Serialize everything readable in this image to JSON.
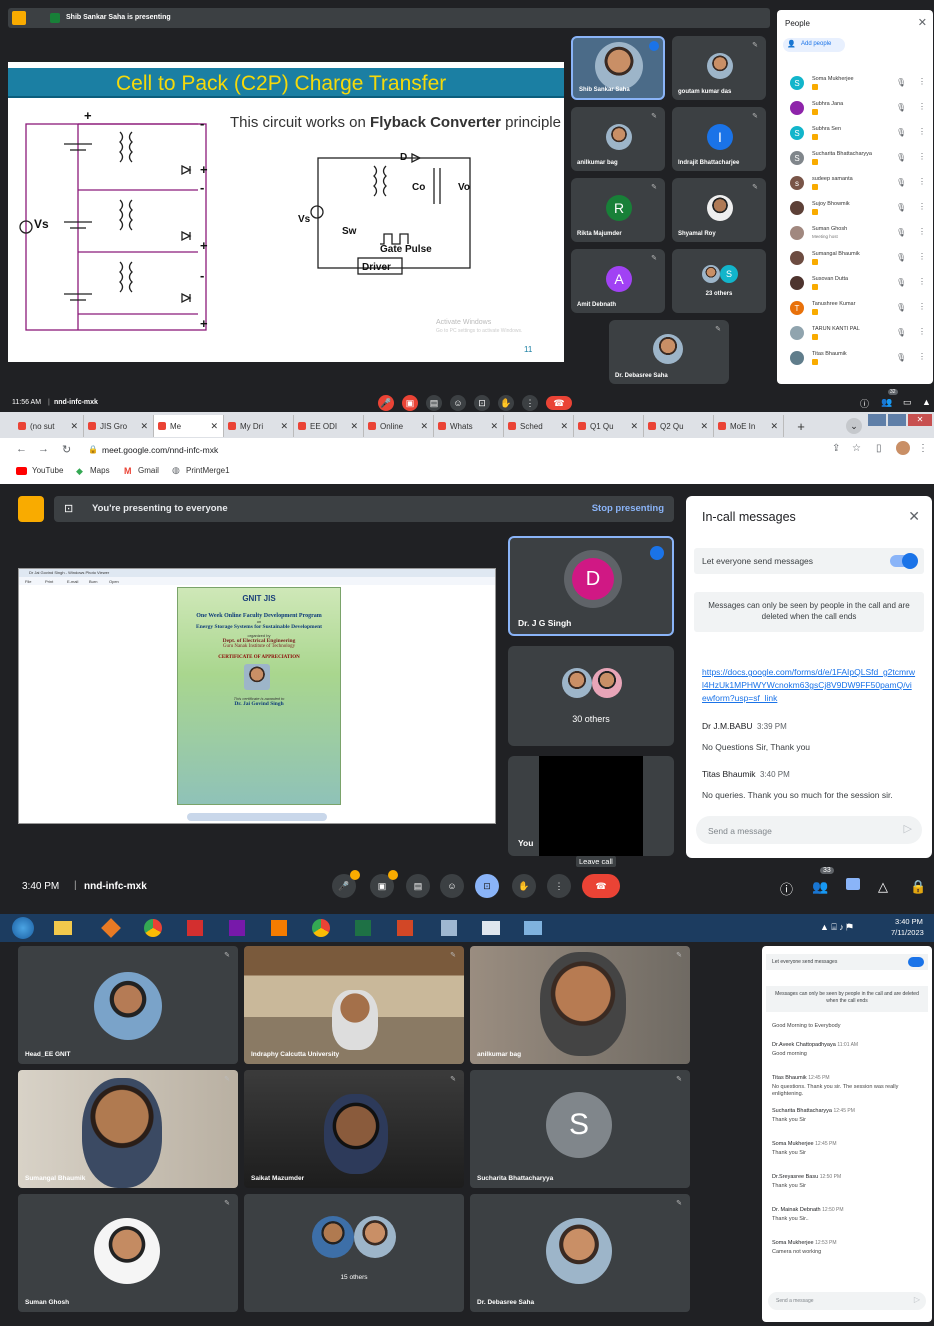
{
  "panel1": {
    "presenting_banner": "Shib Sankar Saha is presenting",
    "slide": {
      "title": "Cell to Pack (C2P) Charge Transfer",
      "subtitle_pre": "This circuit works on ",
      "subtitle_bold": "Flyback Converter",
      "subtitle_post": " principle",
      "label_vs_left": "Vs",
      "label_vs": "Vs",
      "label_d": "D",
      "label_co": "Co",
      "label_vo": "Vo",
      "label_sw": "Sw",
      "label_gate": "Gate Pulse",
      "label_driver": "Driver",
      "plus": "+",
      "minus": "-",
      "watermark1": "Activate Windows",
      "watermark2": "Go to PC settings to activate Windows.",
      "page": "11"
    },
    "tiles": [
      {
        "name": "Shib Sankar Saha"
      },
      {
        "name": "goutam kumar das"
      },
      {
        "name": "anilkumar bag"
      },
      {
        "name": "Indrajit Bhattacharjee",
        "letter": "I",
        "color": "#1a73e8"
      },
      {
        "name": "Rikta Majumder",
        "letter": "R",
        "color": "#188038"
      },
      {
        "name": "Shyamal Roy"
      },
      {
        "name": "Amit Debnath",
        "letter": "A",
        "color": "#a142f4"
      },
      {
        "name": "23 others",
        "letter": "S",
        "color": "#12b5cb"
      },
      {
        "name": "Dr. Debasree Saha"
      }
    ],
    "people": {
      "title": "People",
      "add": "Add people",
      "count": "32",
      "list": [
        {
          "name": "Soma Mukherjee",
          "letter": "S",
          "color": "#12b5cb"
        },
        {
          "name": "Subhra Jana",
          "letter": "",
          "color": "#8e24aa"
        },
        {
          "name": "Subhra Sen",
          "letter": "S",
          "color": "#12b5cb"
        },
        {
          "name": "Sucharita Bhattacharyya",
          "letter": "S",
          "color": "#80868b"
        },
        {
          "name": "sudeep samanta",
          "letter": "s",
          "color": "#795548"
        },
        {
          "name": "Sujoy Bhowmik",
          "letter": "",
          "color": "#5d4037"
        },
        {
          "name": "Suman Ghosh",
          "letter": "",
          "color": "#a1887f",
          "sub": "Meeting host"
        },
        {
          "name": "Sumangal Bhaumik",
          "letter": "",
          "color": "#6d4c41"
        },
        {
          "name": "Susovan Dutta",
          "letter": "",
          "color": "#4e342e"
        },
        {
          "name": "Tanushree Kumar",
          "letter": "T",
          "color": "#e8710a"
        },
        {
          "name": "TARUN KANTI PAL",
          "letter": "",
          "color": "#90a4ae"
        },
        {
          "name": "Titas Bhaumik",
          "letter": "",
          "color": "#607d8b"
        }
      ]
    },
    "clock": "11:56 AM",
    "meeting": "nnd-infc-mxk"
  },
  "browser": {
    "tabs": [
      "(no sut",
      "JIS Gro",
      "Me",
      "My Dri",
      "EE ODI",
      "Online",
      "Whats",
      "Sched",
      "Q1 Qu",
      "Q2 Qu",
      "MoE In"
    ],
    "new_tab": "+",
    "url": "meet.google.com/nnd-infc-mxk",
    "bookmarks": [
      "YouTube",
      "Maps",
      "Gmail",
      "PrintMerge1"
    ]
  },
  "panel2": {
    "banner": "You're presenting to everyone",
    "stop": "Stop presenting",
    "viewer_title": "Dr Jai Govind Singh - Windows Photo Viewer",
    "viewer_menu": [
      "File",
      "Print",
      "E-mail",
      "Burn",
      "Open"
    ],
    "cert": {
      "logos": "GNIT  JIS",
      "program": "One Week Online Faculty Development Program",
      "on": "on",
      "topic": "Energy Storage Systems for Sustainable Development",
      "organized": "organized by",
      "dept": "Dept. of Electrical Engineering",
      "college": "Guru Nanak Institute of Technology",
      "heading": "CERTIFICATE OF APPRECIATION",
      "awarded": "This certificate is awarded to",
      "recipient": "Dr. Jai Govind Singh"
    },
    "tiles": [
      {
        "name": "Dr. J G Singh",
        "letter": "D",
        "color": "#d01884"
      },
      {
        "name": "30 others"
      },
      {
        "name": "You"
      }
    ],
    "tooltip": "Leave call",
    "clock": "3:40 PM",
    "meeting": "nnd-infc-mxk",
    "people_count": "33",
    "chat": {
      "title": "In-call messages",
      "toggle_label": "Let everyone send messages",
      "info": "Messages can only be seen by people in the call and are deleted when the call ends",
      "link": "https://docs.google.com/forms/d/e/1FAIpQLSfd_g2tcmrwl4HzUk1MPHWYWcnokm63gsCj8V9DW9FF50pamQ/viewform?usp=sf_link",
      "messages": [
        {
          "name": "Dr J.M.BABU",
          "time": "3:39 PM",
          "text": "No Questions Sir, Thank you"
        },
        {
          "name": "Titas Bhaumik",
          "time": "3:40 PM",
          "text": "No queries. Thank you so much for the session sir."
        }
      ],
      "placeholder": "Send a message"
    },
    "taskbar_time": "3:40 PM",
    "taskbar_date": "7/11/2023"
  },
  "panel3": {
    "tiles": [
      {
        "name": "Head_EE GNIT"
      },
      {
        "name": "Indraphy Calcutta University"
      },
      {
        "name": "anilkumar bag"
      },
      {
        "name": "Sumangal Bhaumik"
      },
      {
        "name": "Saikat Mazumder"
      },
      {
        "name": "Sucharita Bhattacharyya",
        "letter": "S",
        "color": "#80868b"
      },
      {
        "name": "Suman Ghosh"
      },
      {
        "name": "15 others"
      },
      {
        "name": "Dr. Debasree Saha"
      }
    ],
    "chat": {
      "toggle_label": "Let everyone send messages",
      "info": "Messages can only be seen by people in the call and are deleted when the call ends",
      "partial": "Good Morning to Everybody",
      "messages": [
        {
          "name": "Dr.Aveek Chattopadhyaya",
          "time": "11:01 AM",
          "text": "Good morning"
        },
        {
          "name": "Titas Bhaumik",
          "time": "12:45 PM",
          "text": "No questions. Thank you sir. The session was really enlightening."
        },
        {
          "name": "Sucharita Bhattacharyya",
          "time": "12:45 PM",
          "text": "Thank you Sir"
        },
        {
          "name": "Soma Mukherjee",
          "time": "12:45 PM",
          "text": "Thank you Sir"
        },
        {
          "name": "Dr.Sreyasree Basu",
          "time": "12:50 PM",
          "text": "Thank you Sir"
        },
        {
          "name": "Dr. Mainak Debnath",
          "time": "12:50 PM",
          "text": "Thank you Sir.."
        },
        {
          "name": "Soma Mukherjee",
          "time": "12:53 PM",
          "text": "Camera not working"
        }
      ],
      "placeholder": "Send a message"
    }
  },
  "colors": {
    "dark": "#202124",
    "tile": "#3c4043",
    "red": "#ea4335",
    "blue": "#1a73e8",
    "yellow": "#f9ab00"
  }
}
